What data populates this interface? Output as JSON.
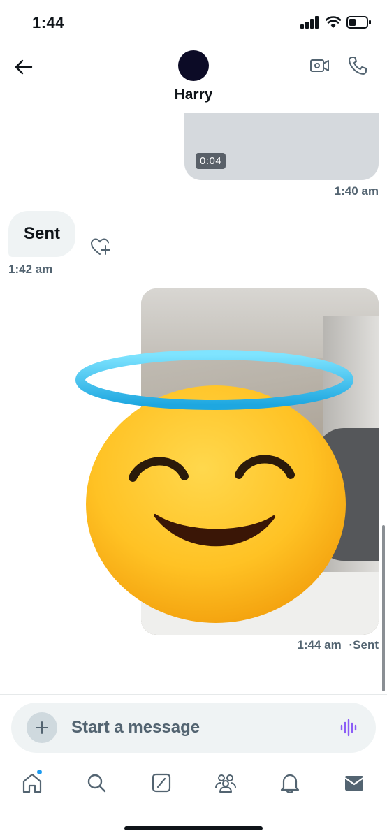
{
  "status_bar": {
    "time": "1:44"
  },
  "header": {
    "contact_name": "Harry"
  },
  "messages": {
    "video": {
      "duration": "0:04",
      "timestamp": "1:40 am"
    },
    "text": {
      "body": "Sent",
      "timestamp": "1:42 am"
    },
    "photo": {
      "timestamp": "1:44 am",
      "status": "·Sent"
    }
  },
  "composer": {
    "placeholder": "Start a message"
  },
  "tabs": [
    "home",
    "search",
    "grok",
    "communities",
    "notifications",
    "messages"
  ],
  "colors": {
    "accent": "#1d9bf0",
    "voice": "#8b5cf6",
    "bubble": "#eff3f4",
    "muted": "#536471"
  },
  "icons": {
    "back": "arrow-left-icon",
    "video": "video-camera-icon",
    "phone": "phone-icon",
    "react": "heart-plus-icon",
    "plus": "plus-icon",
    "voice": "waveform-icon"
  }
}
